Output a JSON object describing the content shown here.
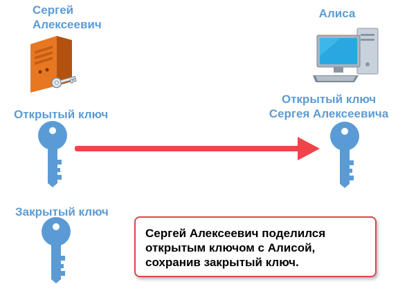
{
  "sender": {
    "name_lines": [
      "Сергей",
      "Алексеевич"
    ],
    "public_key_label": "Открытый ключ",
    "private_key_label": "Закрытый ключ"
  },
  "recipient": {
    "name": "Алиса",
    "received_key_lines": [
      "Открытый ключ",
      "Сергея Алексеевича"
    ]
  },
  "message": {
    "lines": [
      "Сергей Алексеевич поделился",
      "открытым ключом с Алисой,",
      "сохранив закрытый ключ."
    ]
  },
  "icons": {
    "sender": "server-icon",
    "recipient": "computer-icon",
    "keys": "key-icon",
    "transfer": "arrow-right-icon"
  },
  "colors": {
    "label_blue": "#5b9bd5",
    "key_blue": "#5b9bd5",
    "arrow_red": "#f0434a",
    "box_border": "#e0454a",
    "server_orange": "#e87722"
  }
}
